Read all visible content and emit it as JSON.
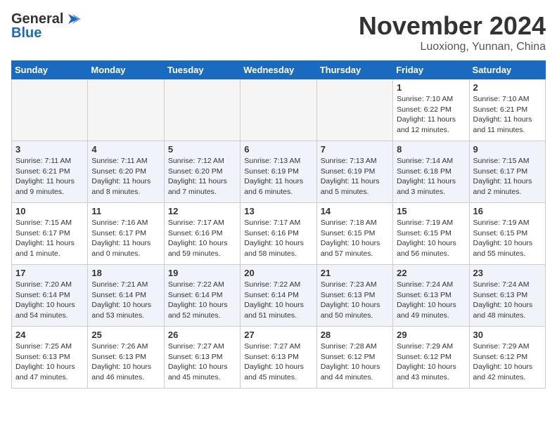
{
  "header": {
    "logo_general": "General",
    "logo_blue": "Blue",
    "month_title": "November 2024",
    "location": "Luoxiong, Yunnan, China"
  },
  "weekdays": [
    "Sunday",
    "Monday",
    "Tuesday",
    "Wednesday",
    "Thursday",
    "Friday",
    "Saturday"
  ],
  "weeks": [
    [
      {
        "day": "",
        "info": ""
      },
      {
        "day": "",
        "info": ""
      },
      {
        "day": "",
        "info": ""
      },
      {
        "day": "",
        "info": ""
      },
      {
        "day": "",
        "info": ""
      },
      {
        "day": "1",
        "info": "Sunrise: 7:10 AM\nSunset: 6:22 PM\nDaylight: 11 hours and 12 minutes."
      },
      {
        "day": "2",
        "info": "Sunrise: 7:10 AM\nSunset: 6:21 PM\nDaylight: 11 hours and 11 minutes."
      }
    ],
    [
      {
        "day": "3",
        "info": "Sunrise: 7:11 AM\nSunset: 6:21 PM\nDaylight: 11 hours and 9 minutes."
      },
      {
        "day": "4",
        "info": "Sunrise: 7:11 AM\nSunset: 6:20 PM\nDaylight: 11 hours and 8 minutes."
      },
      {
        "day": "5",
        "info": "Sunrise: 7:12 AM\nSunset: 6:20 PM\nDaylight: 11 hours and 7 minutes."
      },
      {
        "day": "6",
        "info": "Sunrise: 7:13 AM\nSunset: 6:19 PM\nDaylight: 11 hours and 6 minutes."
      },
      {
        "day": "7",
        "info": "Sunrise: 7:13 AM\nSunset: 6:19 PM\nDaylight: 11 hours and 5 minutes."
      },
      {
        "day": "8",
        "info": "Sunrise: 7:14 AM\nSunset: 6:18 PM\nDaylight: 11 hours and 3 minutes."
      },
      {
        "day": "9",
        "info": "Sunrise: 7:15 AM\nSunset: 6:17 PM\nDaylight: 11 hours and 2 minutes."
      }
    ],
    [
      {
        "day": "10",
        "info": "Sunrise: 7:15 AM\nSunset: 6:17 PM\nDaylight: 11 hours and 1 minute."
      },
      {
        "day": "11",
        "info": "Sunrise: 7:16 AM\nSunset: 6:17 PM\nDaylight: 11 hours and 0 minutes."
      },
      {
        "day": "12",
        "info": "Sunrise: 7:17 AM\nSunset: 6:16 PM\nDaylight: 10 hours and 59 minutes."
      },
      {
        "day": "13",
        "info": "Sunrise: 7:17 AM\nSunset: 6:16 PM\nDaylight: 10 hours and 58 minutes."
      },
      {
        "day": "14",
        "info": "Sunrise: 7:18 AM\nSunset: 6:15 PM\nDaylight: 10 hours and 57 minutes."
      },
      {
        "day": "15",
        "info": "Sunrise: 7:19 AM\nSunset: 6:15 PM\nDaylight: 10 hours and 56 minutes."
      },
      {
        "day": "16",
        "info": "Sunrise: 7:19 AM\nSunset: 6:15 PM\nDaylight: 10 hours and 55 minutes."
      }
    ],
    [
      {
        "day": "17",
        "info": "Sunrise: 7:20 AM\nSunset: 6:14 PM\nDaylight: 10 hours and 54 minutes."
      },
      {
        "day": "18",
        "info": "Sunrise: 7:21 AM\nSunset: 6:14 PM\nDaylight: 10 hours and 53 minutes."
      },
      {
        "day": "19",
        "info": "Sunrise: 7:22 AM\nSunset: 6:14 PM\nDaylight: 10 hours and 52 minutes."
      },
      {
        "day": "20",
        "info": "Sunrise: 7:22 AM\nSunset: 6:14 PM\nDaylight: 10 hours and 51 minutes."
      },
      {
        "day": "21",
        "info": "Sunrise: 7:23 AM\nSunset: 6:13 PM\nDaylight: 10 hours and 50 minutes."
      },
      {
        "day": "22",
        "info": "Sunrise: 7:24 AM\nSunset: 6:13 PM\nDaylight: 10 hours and 49 minutes."
      },
      {
        "day": "23",
        "info": "Sunrise: 7:24 AM\nSunset: 6:13 PM\nDaylight: 10 hours and 48 minutes."
      }
    ],
    [
      {
        "day": "24",
        "info": "Sunrise: 7:25 AM\nSunset: 6:13 PM\nDaylight: 10 hours and 47 minutes."
      },
      {
        "day": "25",
        "info": "Sunrise: 7:26 AM\nSunset: 6:13 PM\nDaylight: 10 hours and 46 minutes."
      },
      {
        "day": "26",
        "info": "Sunrise: 7:27 AM\nSunset: 6:13 PM\nDaylight: 10 hours and 45 minutes."
      },
      {
        "day": "27",
        "info": "Sunrise: 7:27 AM\nSunset: 6:13 PM\nDaylight: 10 hours and 45 minutes."
      },
      {
        "day": "28",
        "info": "Sunrise: 7:28 AM\nSunset: 6:12 PM\nDaylight: 10 hours and 44 minutes."
      },
      {
        "day": "29",
        "info": "Sunrise: 7:29 AM\nSunset: 6:12 PM\nDaylight: 10 hours and 43 minutes."
      },
      {
        "day": "30",
        "info": "Sunrise: 7:29 AM\nSunset: 6:12 PM\nDaylight: 10 hours and 42 minutes."
      }
    ]
  ]
}
